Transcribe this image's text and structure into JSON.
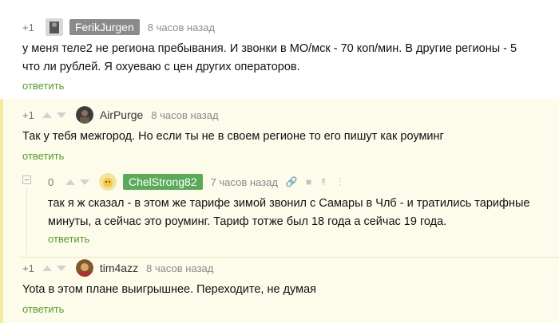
{
  "comments": [
    {
      "rating": "+1",
      "username": "FerikJurgen",
      "badge_color": "#8a8a8a",
      "time": "8 часов назад",
      "text_lines": [
        "у меня теле2 не региона пребывания. И звонки в МО/мск - 70 коп/мин. В другие регионы - 5",
        "что ли рублей. Я охуеваю с цен других операторов."
      ],
      "reply": "ответить"
    },
    {
      "rating": "+1",
      "username": "AirPurge",
      "time": "8 часов назад",
      "text_lines": [
        "Так у тебя межгород. Но если ты не в своем регионе то его пишут как роуминг"
      ],
      "reply": "ответить"
    },
    {
      "rating": "0",
      "username": "ChelStrong82",
      "badge_color": "#5aaa5a",
      "time": "7 часов назад",
      "text_lines": [
        "так я ж сказал - в этом же тарифе зимой звонил с Самары в Члб - и тратились тарифные",
        "минуты, а сейчас это роуминг. Тариф тотже был 18 года а сейчас 19 года."
      ],
      "reply": "ответить"
    },
    {
      "rating": "+1",
      "username": "tim4azz",
      "time": "8 часов назад",
      "text_lines": [
        "Yota в этом плане выигрышнее. Переходите, не думая"
      ],
      "reply": "ответить"
    }
  ],
  "colors": {
    "reply": "#5a9a2e",
    "thread_bg": "#fdfbea",
    "stripe": "#f4ea9e"
  }
}
